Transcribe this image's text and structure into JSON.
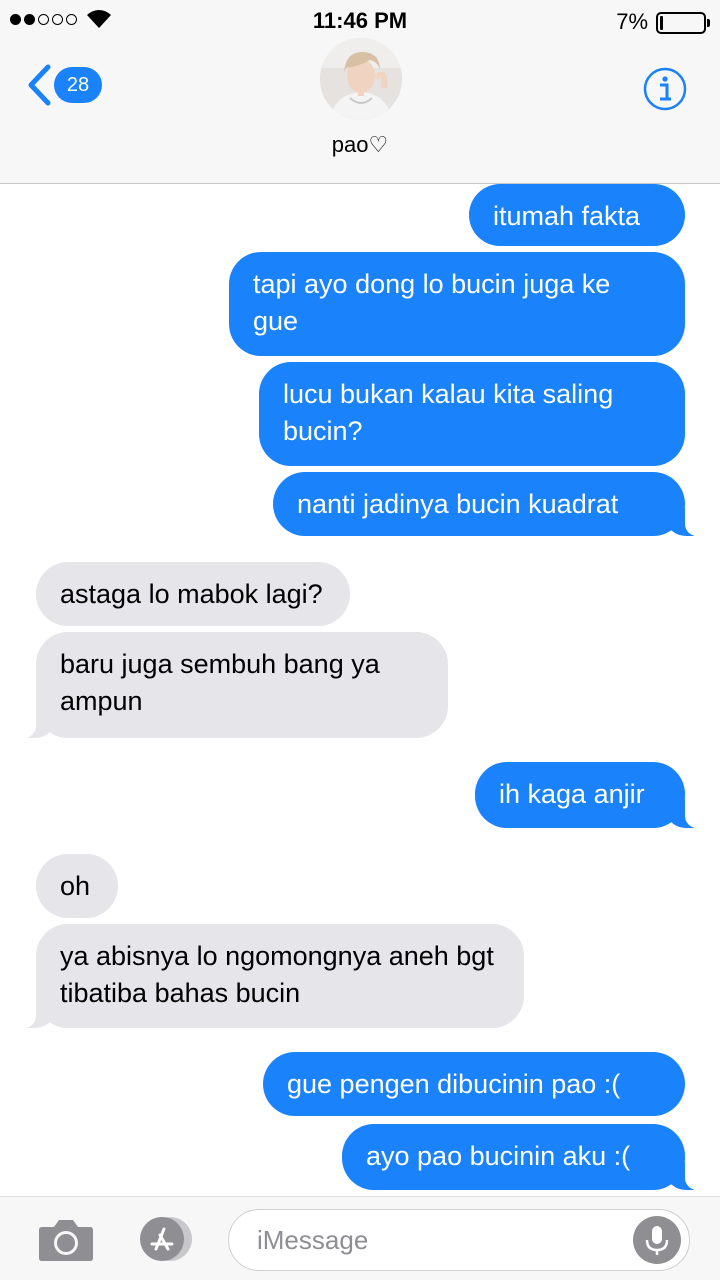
{
  "status_bar": {
    "time": "11:46 PM",
    "battery_percent": "7%",
    "battery_level": 0.07,
    "signal_bars_filled": 2,
    "signal_bars_total": 5
  },
  "header": {
    "back_badge": "28",
    "contact_name": "pao♡",
    "info_icon": "info-circle-icon",
    "back_icon": "chevron-left-icon"
  },
  "messages": [
    {
      "from": "me",
      "text": "itumah fakta"
    },
    {
      "from": "me",
      "text": "tapi ayo dong lo bucin juga ke gue"
    },
    {
      "from": "me",
      "text": "lucu bukan kalau kita saling bucin?"
    },
    {
      "from": "me",
      "text": "nanti jadinya bucin kuadrat"
    },
    {
      "from": "them",
      "text": "astaga lo mabok lagi?"
    },
    {
      "from": "them",
      "text": "baru juga sembuh bang ya ampun"
    },
    {
      "from": "me",
      "text": "ih kaga anjir"
    },
    {
      "from": "them",
      "text": "oh"
    },
    {
      "from": "them",
      "text": "ya abisnya lo ngomongnya aneh bgt tibatiba bahas bucin"
    },
    {
      "from": "me",
      "text": "gue pengen dibucinin pao :("
    },
    {
      "from": "me",
      "text": "ayo pao bucinin aku :("
    }
  ],
  "input_bar": {
    "placeholder": "iMessage",
    "camera_icon": "camera-icon",
    "appstore_icon": "app-store-icon",
    "mic_icon": "microphone-icon"
  },
  "colors": {
    "accent": "#1a82fb",
    "incoming_bubble": "#e5e5ea",
    "header_bg": "#f7f7f7"
  }
}
